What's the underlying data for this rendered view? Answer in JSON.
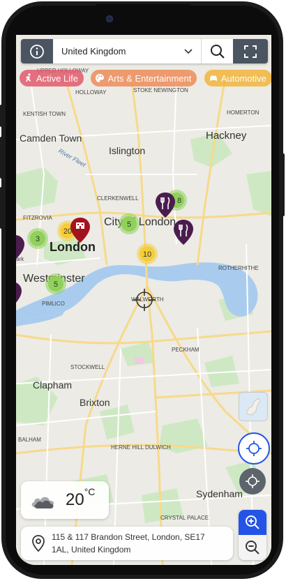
{
  "search": {
    "country_value": "United Kingdom"
  },
  "categories": [
    {
      "label": "Active Life",
      "color": "#e25b6e",
      "icon": "person-running-icon"
    },
    {
      "label": "Arts & Entertainment",
      "color": "#ee8d5a",
      "icon": "palette-icon"
    },
    {
      "label": "Automotive",
      "color": "#f2b53b",
      "icon": "car-icon"
    }
  ],
  "map": {
    "labels": {
      "upper_holloway": "UPPER HOLLOWAY",
      "holloway": "HOLLOWAY",
      "stoke_newington": "STOKE NEWINGTON",
      "kentish_town": "KENTISH TOWN",
      "homerton": "HOMERTON",
      "camden_town": "Camden Town",
      "islington": "Islington",
      "hackney": "Hackney",
      "river_fleet": "River Fleet",
      "clerkenwell": "CLERKENWELL",
      "fitzrovia": "FITZROVIA",
      "city_of_london": "City of London",
      "london": "London",
      "rotherhithe": "ROTHERHITHE",
      "westminster": "Westminster",
      "pimlico": "PIMLICO",
      "walworth": "WALWORTH",
      "peckham": "PECKHAM",
      "stockwell": "STOCKWELL",
      "clapham": "Clapham",
      "brixton": "Brixton",
      "balham": "BALHAM",
      "dulwich": "DULWICH",
      "herne_hill": "HERNE HILL",
      "sydenham": "Sydenham",
      "crystal_palace": "CRYSTAL PALACE",
      "park": "ark"
    },
    "clusters": [
      {
        "count": "3",
        "color": "green"
      },
      {
        "count": "20",
        "color": "yellow"
      },
      {
        "count": "5",
        "color": "green"
      },
      {
        "count": "5",
        "color": "green"
      },
      {
        "count": "10",
        "color": "yellow"
      },
      {
        "count": "8",
        "color": "green"
      }
    ]
  },
  "weather": {
    "temperature": "20",
    "unit": "°C",
    "icon": "cloudy-icon"
  },
  "address": {
    "line1": "115 & 117 Brandon Street, London, SE17",
    "line2": "1AL, United Kingdom"
  },
  "colors": {
    "accent_blue": "#2454e6",
    "dark_gray": "#4b5561",
    "pin_purple": "#4a1d4e",
    "pin_red": "#a3131d",
    "cluster_green": "#8fd15a",
    "cluster_yellow": "#f5cd3a"
  }
}
